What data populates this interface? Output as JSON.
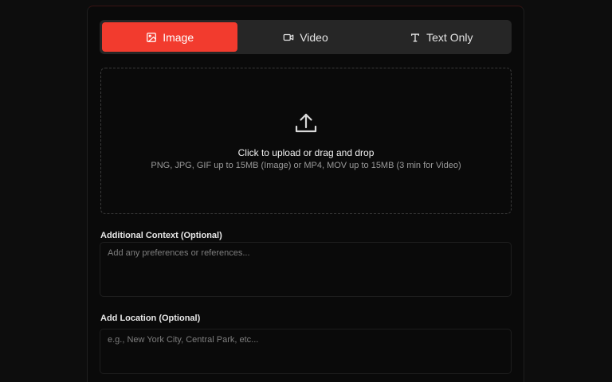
{
  "tabs": [
    {
      "label": "Image",
      "icon": "image-icon",
      "active": true
    },
    {
      "label": "Video",
      "icon": "video-icon",
      "active": false
    },
    {
      "label": "Text Only",
      "icon": "text-icon",
      "active": false
    }
  ],
  "upload": {
    "icon": "upload-icon",
    "title": "Click to upload or drag and drop",
    "subtitle": "PNG, JPG, GIF up to 15MB (Image) or MP4, MOV up to 15MB (3 min for Video)"
  },
  "context": {
    "label": "Additional Context (Optional)",
    "placeholder": "Add any preferences or references..."
  },
  "location": {
    "label": "Add Location (Optional)",
    "placeholder": "e.g., New York City, Central Park, etc..."
  },
  "colors": {
    "accent": "#f23b2e",
    "background": "#0d0d0d",
    "tab_bar": "#262626"
  }
}
